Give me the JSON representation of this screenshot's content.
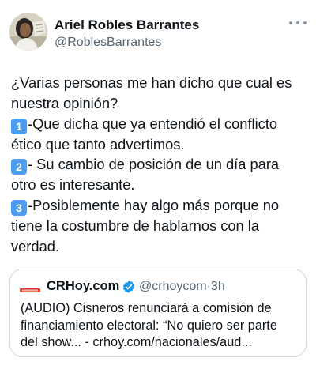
{
  "author": {
    "name": "Ariel Robles Barrantes",
    "handle": "@RoblesBarrantes"
  },
  "tweet": {
    "lines": [
      "¿Varias personas me han dicho que cual es",
      "nuestra opinión?",
      "-Que dicha que ya entendió el conflicto",
      "ético que tanto advertimos.",
      "- Su cambio de posición de un día para",
      "otro es interesante.",
      "-Posiblemente hay algo más porque no",
      "tiene la costumbre de hablarnos con la",
      "verdad."
    ],
    "keycaps": [
      "1",
      "2",
      "3"
    ]
  },
  "quoted": {
    "name": "CRHoy.com",
    "handle": "@crhoycom",
    "separator": "·",
    "time": "3h",
    "lines": [
      "(AUDIO) Cisneros renunciará a comisión de",
      "financiamiento electoral: “No quiero ser parte",
      "del show... - crhoy.com/nacionales/aud..."
    ]
  },
  "colors": {
    "text": "#0f1419",
    "secondary": "#536471",
    "keycap": "#4a9df0",
    "verified": "#1d9bf0",
    "border": "#cfd9de"
  },
  "icons": {
    "more": "more-dots-icon",
    "verified": "verified-badge-icon",
    "keycap": "keycap-digit-icon"
  }
}
